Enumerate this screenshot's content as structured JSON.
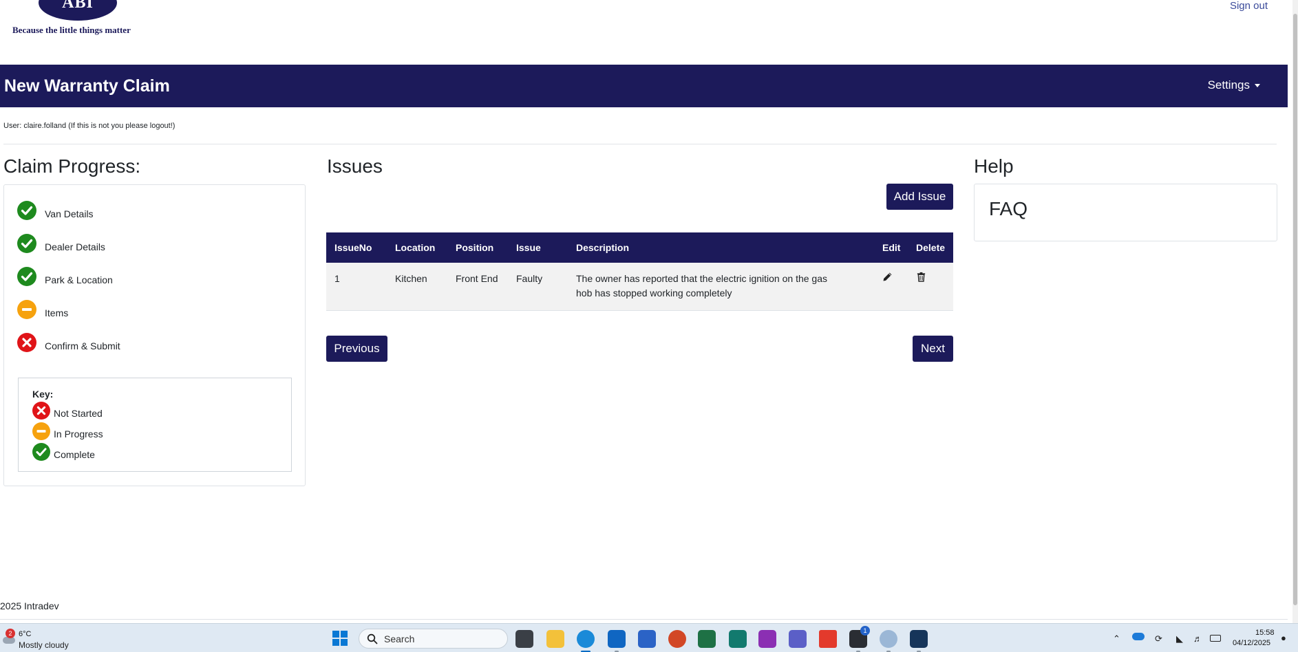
{
  "brand": {
    "logo_text": "ABI",
    "tagline": "Because the little things matter"
  },
  "header": {
    "sign_out": "Sign out"
  },
  "navbar": {
    "title": "New Warranty Claim",
    "settings": "Settings"
  },
  "user_line": "User: claire.folland (If this is not you please logout!)",
  "progress": {
    "heading": "Claim Progress:",
    "steps": [
      {
        "label": "Van Details",
        "status": "complete"
      },
      {
        "label": "Dealer Details",
        "status": "complete"
      },
      {
        "label": "Park & Location",
        "status": "complete"
      },
      {
        "label": "Items",
        "status": "in-progress"
      },
      {
        "label": "Confirm & Submit",
        "status": "not-started"
      }
    ],
    "key": {
      "title": "Key:",
      "items": [
        {
          "label": "Not Started",
          "status": "not-started"
        },
        {
          "label": "In Progress",
          "status": "in-progress"
        },
        {
          "label": "Complete",
          "status": "complete"
        }
      ]
    },
    "status_colors": {
      "complete": "#1e8a1e",
      "in-progress": "#f6a20e",
      "not-started": "#e01418"
    }
  },
  "issues": {
    "heading": "Issues",
    "add_button": "Add Issue",
    "columns": [
      "IssueNo",
      "Location",
      "Position",
      "Issue",
      "Description",
      "Edit",
      "Delete"
    ],
    "rows": [
      {
        "issue_no": "1",
        "location": "Kitchen",
        "position": "Front End",
        "issue": "Faulty",
        "description": "The owner has reported that the electric ignition on the gas hob has stopped working completely",
        "edit_icon": "pencil-icon",
        "delete_icon": "trash-icon"
      }
    ],
    "previous_button": "Previous",
    "next_button": "Next"
  },
  "help": {
    "heading": "Help",
    "faq": "FAQ"
  },
  "footer": {
    "text": "2025 Intradev"
  },
  "colors": {
    "brand_navy": "#1c1a5a"
  },
  "taskbar": {
    "weather": {
      "badge": "2",
      "temperature": "6°C",
      "condition": "Mostly cloudy"
    },
    "search_label": "Search",
    "apps": [
      "windows-start",
      "file-explorer",
      "edge",
      "outlook",
      "word",
      "powerpoint",
      "excel",
      "project",
      "onenote",
      "teams",
      "acrobat",
      "terminal",
      "remote-desktop",
      "tasks"
    ],
    "terminal_badge": "1",
    "clock": {
      "time": "15:58",
      "date": "04/12/2025"
    }
  }
}
